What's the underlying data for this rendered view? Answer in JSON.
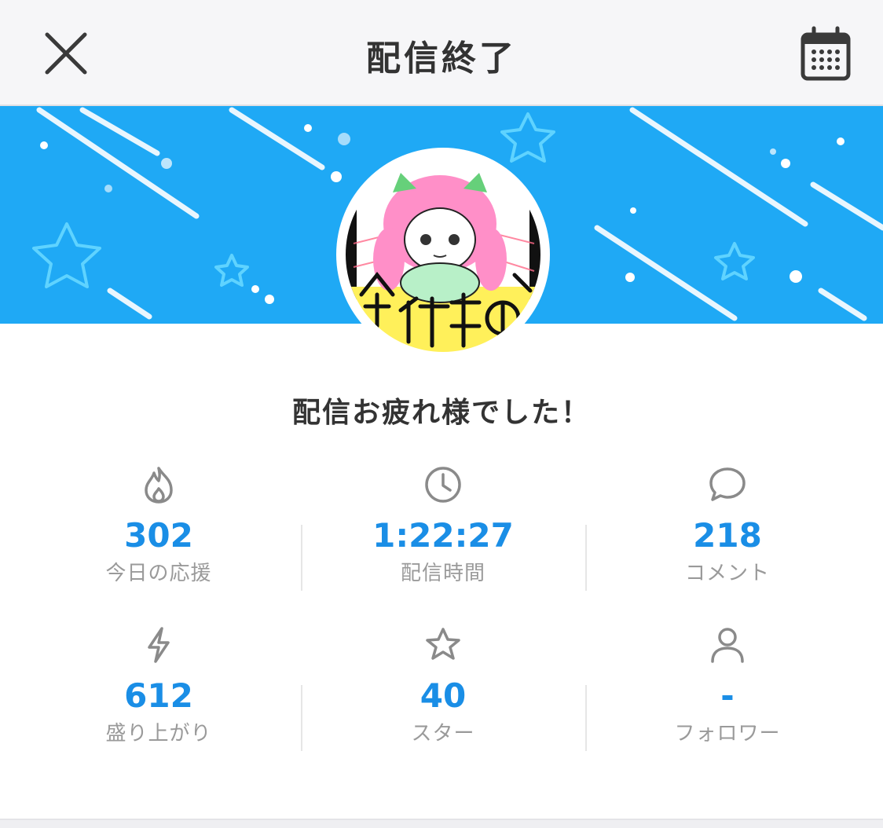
{
  "header": {
    "title": "配信終了",
    "close_icon": "close-icon",
    "calendar_icon": "calendar-icon"
  },
  "banner": {
    "color": "#1fa9f5"
  },
  "greeting": "配信お疲れ様でした！",
  "stats": [
    {
      "icon": "fire-icon",
      "value": "302",
      "label": "今日の応援"
    },
    {
      "icon": "clock-icon",
      "value": "1:22:27",
      "label": "配信時間"
    },
    {
      "icon": "comment-icon",
      "value": "218",
      "label": "コメント"
    },
    {
      "icon": "lightning-icon",
      "value": "612",
      "label": "盛り上がり"
    },
    {
      "icon": "star-icon",
      "value": "40",
      "label": "スター"
    },
    {
      "icon": "user-icon",
      "value": "-",
      "label": "フォロワー"
    }
  ],
  "colors": {
    "accent": "#1a8ee6",
    "label": "#9a9a9a",
    "text": "#333333"
  }
}
